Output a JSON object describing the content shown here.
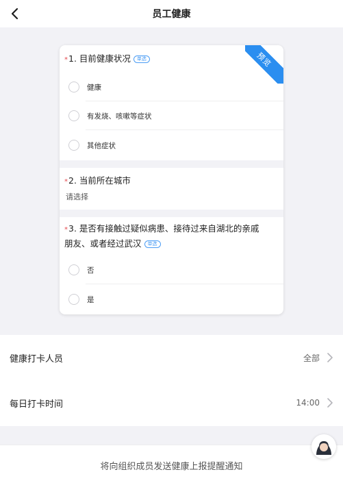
{
  "header": {
    "title": "员工健康"
  },
  "preview": {
    "ribbon": "预览",
    "questions": [
      {
        "required_mark": "*",
        "title": "1. 目前健康状况",
        "tag": "单选",
        "options": [
          "健康",
          "有发烧、咳嗽等症状",
          "其他症状"
        ]
      },
      {
        "required_mark": "*",
        "title": "2. 当前所在城市",
        "placeholder": "请选择"
      },
      {
        "required_mark": "*",
        "title_line1": "3. 是否有接触过疑似病患、接待过来自湖北的亲戚",
        "title_line2": "朋友、或者经过武汉",
        "tag": "单选",
        "options": [
          "否",
          "是"
        ]
      }
    ]
  },
  "settings": {
    "members": {
      "label": "健康打卡人员",
      "value": "全部"
    },
    "time": {
      "label": "每日打卡时间",
      "value": "14:00"
    }
  },
  "bottom": {
    "notice": "将向组织成员发送健康上报提醒通知"
  },
  "colors": {
    "accent": "#2b8ef0",
    "required": "#e5484d",
    "background": "#f2f2f6"
  },
  "icons": {
    "back": "chevron-left-icon",
    "row_arrow": "chevron-right-icon",
    "floating": "avatar-icon"
  }
}
